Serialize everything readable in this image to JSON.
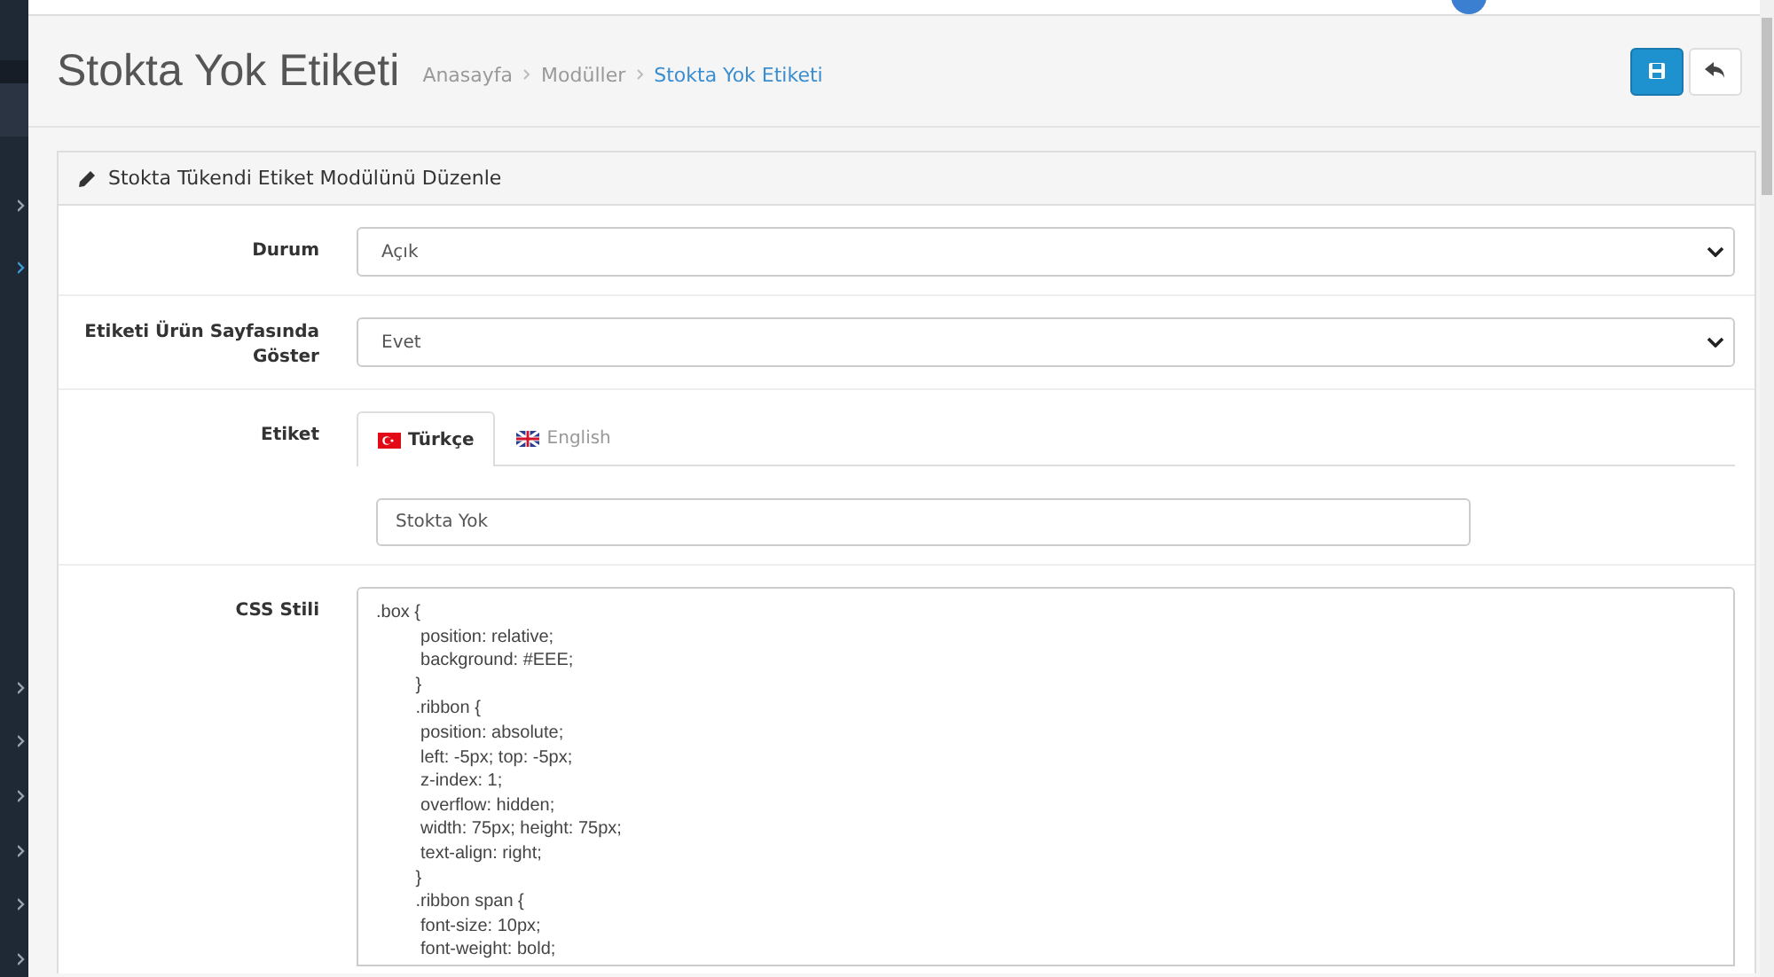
{
  "header": {
    "title": "Stokta Yok Etiketi",
    "breadcrumb": [
      {
        "label": "Anasayfa",
        "current": false
      },
      {
        "label": "Modüller",
        "current": false
      },
      {
        "label": "Stokta Yok Etiketi",
        "current": true
      }
    ]
  },
  "panel": {
    "title": "Stokta Tükendi Etiket Modülünü Düzenle",
    "fields": [
      {
        "kind": "select",
        "label": "Durum",
        "value": "Açık"
      },
      {
        "kind": "select",
        "label": "Etiketi Ürün Sayfasında Göster",
        "value": "Evet"
      },
      {
        "kind": "tabs",
        "label": "Etiket",
        "tabs": [
          {
            "label": "Türkçe",
            "kind": "turkish",
            "selected": true
          },
          {
            "label": "English",
            "kind": "british",
            "selected": false
          }
        ],
        "value": "Stokta Yok"
      },
      {
        "kind": "code",
        "label": "CSS Stili",
        "value": ".box {\n         position: relative;\n         background: #EEE;\n        }\n        .ribbon {\n         position: absolute;\n         left: -5px; top: -5px;\n         z-index: 1;\n         overflow: hidden;\n         width: 75px; height: 75px;\n         text-align: right;\n        }\n        .ribbon span {\n         font-size: 10px;\n         font-weight: bold;"
      }
    ]
  }
}
